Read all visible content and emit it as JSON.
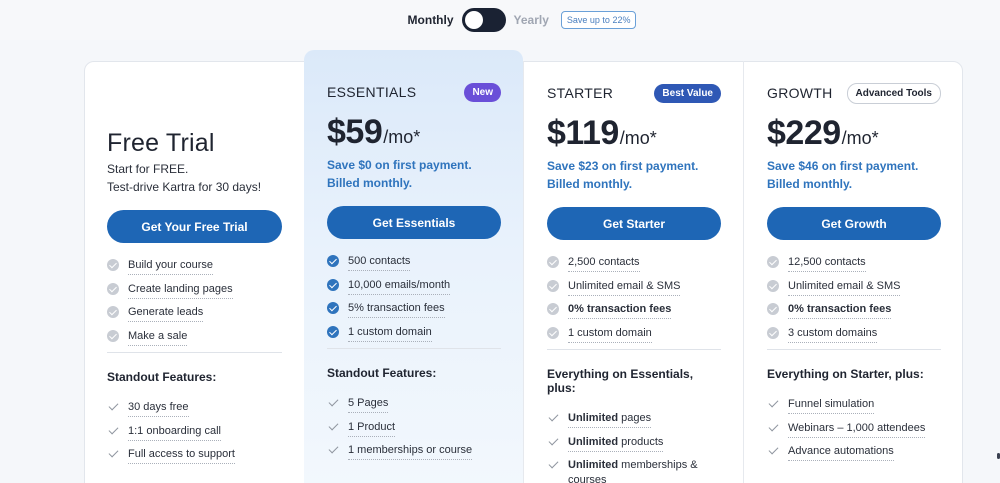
{
  "toggle": {
    "monthly": "Monthly",
    "yearly": "Yearly",
    "save_badge": "Save up to 22%"
  },
  "plans": {
    "free": {
      "title": "Free Trial",
      "sub1": "Start for FREE.",
      "sub2": "Test-drive Kartra for 30 days!",
      "cta": "Get Your Free Trial",
      "features": [
        "Build your course",
        "Create landing pages",
        "Generate leads",
        "Make a sale"
      ],
      "standout_heading": "Standout Features:",
      "standout": [
        "30 days free",
        "1:1 onboarding call",
        "Full access to support"
      ]
    },
    "essentials": {
      "name": "ESSENTIALS",
      "badge": "New",
      "price": "$59",
      "per": "/mo*",
      "save1": "Save $0 on first payment.",
      "save2": "Billed monthly.",
      "cta": "Get Essentials",
      "features": [
        "500 contacts",
        "10,000 emails/month",
        "5% transaction fees",
        "1 custom domain"
      ],
      "standout_heading": "Standout Features:",
      "standout": [
        "5 Pages",
        "1 Product",
        "1 memberships or course"
      ]
    },
    "starter": {
      "name": "STARTER",
      "badge": "Best Value",
      "price": "$119",
      "per": "/mo*",
      "save1": "Save $23 on first payment.",
      "save2": "Billed monthly.",
      "cta": "Get Starter",
      "features": [
        "2,500 contacts",
        "Unlimited email & SMS",
        "0% transaction fees",
        "1 custom domain"
      ],
      "standout_heading": "Everything on Essentials, plus:",
      "standout_bold": [
        "Unlimited",
        "Unlimited",
        "Unlimited"
      ],
      "standout_rest": [
        " pages",
        " products",
        " memberships &"
      ],
      "standout_wrap": "courses"
    },
    "growth": {
      "name": "GROWTH",
      "badge": "Advanced Tools",
      "price": "$229",
      "per": "/mo*",
      "save1": "Save $46 on first payment.",
      "save2": "Billed monthly.",
      "cta": "Get Growth",
      "features": [
        "12,500 contacts",
        "Unlimited email & SMS",
        "0% transaction fees",
        "3 custom domains"
      ],
      "standout_heading": "Everything on Starter, plus:",
      "standout": [
        "Funnel simulation",
        "Webinars – 1,000 attendees",
        "Advance automations"
      ]
    }
  },
  "colors": {
    "cta": "#1e66b5",
    "accent_text": "#2f74bd",
    "badge_new": "#6a4fd8",
    "badge_best": "#2f58b5"
  }
}
